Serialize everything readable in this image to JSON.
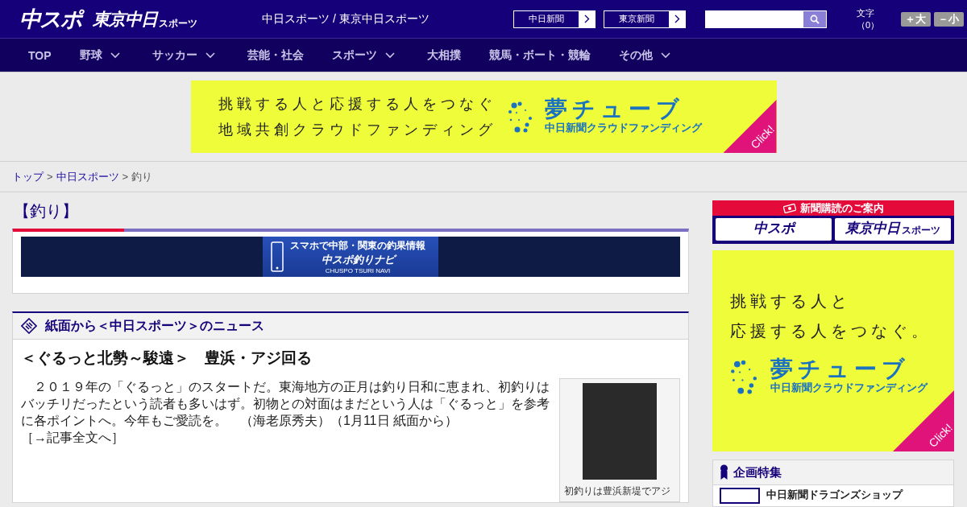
{
  "header": {
    "logo_main": "中スポ",
    "logo_sub": "東京中日",
    "logo_sub_small": "スポーツ",
    "site_names": "中日スポーツ / 東京中日スポーツ",
    "links": [
      {
        "label": "中日新聞"
      },
      {
        "label": "東京新聞"
      }
    ],
    "text_size_label": "文字（0）",
    "size_buttons": [
      "＋大",
      "－小"
    ]
  },
  "nav": [
    {
      "label": "TOP",
      "has_dropdown": false
    },
    {
      "label": "野球",
      "has_dropdown": true
    },
    {
      "label": "サッカー",
      "has_dropdown": true
    },
    {
      "label": "芸能・社会",
      "has_dropdown": false
    },
    {
      "label": "スポーツ",
      "has_dropdown": true
    },
    {
      "label": "大相撲",
      "has_dropdown": false
    },
    {
      "label": "競馬・ボート・競輪",
      "has_dropdown": false
    },
    {
      "label": "その他",
      "has_dropdown": true
    }
  ],
  "top_ad": {
    "lines": [
      "挑戦する人と応援する人をつなぐ",
      "地域共創クラウドファンディング"
    ],
    "brand": "夢チューブ",
    "brand_sub": "中日新聞クラウドファンディング",
    "click": "Click!"
  },
  "breadcrumb": {
    "separator": ">",
    "items": [
      {
        "label": "トップ",
        "link": true
      },
      {
        "label": "中日スポーツ",
        "link": true
      },
      {
        "label": "釣り",
        "link": false
      }
    ]
  },
  "category": {
    "title": "【釣り】"
  },
  "navi_banner": {
    "line1": "スマホで中部・関東の釣果情報",
    "line2": "中スポ釣りナビ",
    "line3": "CHUSPO TSURI NAVI"
  },
  "news_section": {
    "title": "紙面から＜中日スポーツ＞のニュース",
    "headline": "＜ぐるっと北勢～駿遠＞　豊浜・アジ回る",
    "body": "　２０１９年の「ぐるっと」のスタートだ。東海地方の正月は釣り日和に恵まれ、初釣りはバッチリだったという読者も多いはず。初物との対面はまだという人は「ぐるっと」を参考に各ポイントへ。今年もご愛読を。　（海老原秀夫）（1月11日 紙面から）　",
    "more_link": "［→記事全文へ］",
    "photo_caption": "初釣りは豊浜新堤でアジ"
  },
  "subscribe": {
    "title": "新聞購読のご案内",
    "buttons": [
      {
        "main": "中スポ"
      },
      {
        "main": "東京中日",
        "small": "スポーツ"
      }
    ]
  },
  "side_ad": {
    "lines": [
      "挑戦する人と",
      "応援する人をつなぐ。"
    ],
    "brand": "夢チューブ",
    "brand_sub": "中日新聞クラウドファンディング",
    "click": "Click!"
  },
  "features": {
    "title": "企画特集",
    "items": [
      {
        "label": "中日新聞ドラゴンズショップ"
      }
    ]
  }
}
